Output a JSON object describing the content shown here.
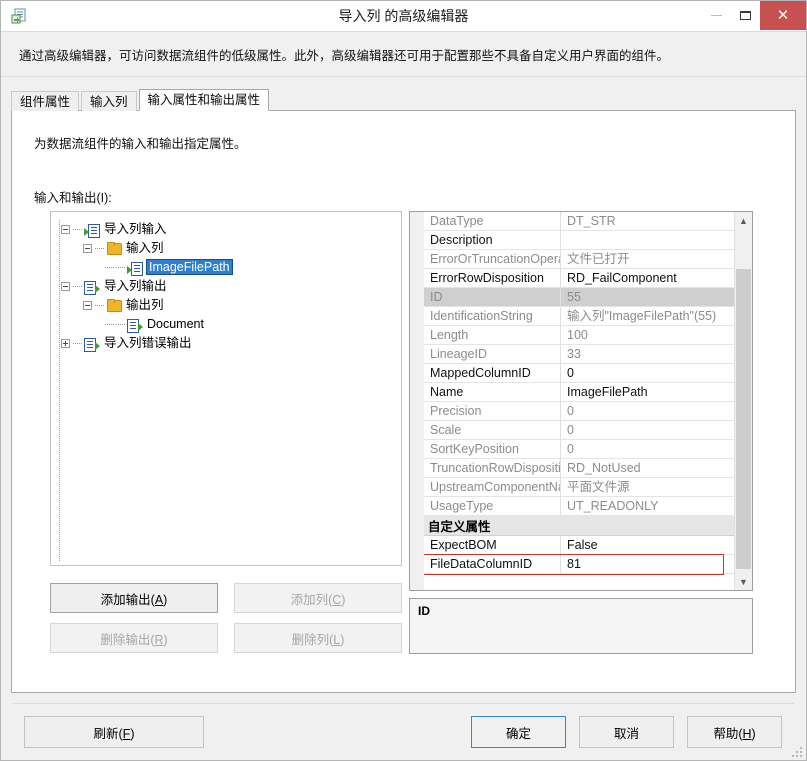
{
  "window": {
    "title": "导入列 的高级编辑器",
    "app_icon": "import-column-icon",
    "minimize_label": "最小化",
    "maximize_label": "最大化",
    "close_label": "关闭"
  },
  "description_strip": {
    "text": "通过高级编辑器，可访问数据流组件的低级属性。此外，高级编辑器还可用于配置那些不具备自定义用户界面的组件。"
  },
  "tabs": [
    {
      "label": "组件属性",
      "active": false
    },
    {
      "label": "输入列",
      "active": false
    },
    {
      "label": "输入属性和输出属性",
      "active": true
    }
  ],
  "tab_body": {
    "hint": "为数据流组件的输入和输出指定属性。",
    "io_label": "输入和输出(I):"
  },
  "tree": {
    "nodes": [
      {
        "level": 1,
        "expander": "minus",
        "icon": "input-icon",
        "label": "导入列输入",
        "selected": false
      },
      {
        "level": 2,
        "expander": "minus",
        "icon": "folder-icon",
        "label": "输入列",
        "selected": false
      },
      {
        "level": 3,
        "expander": "none",
        "icon": "input-icon",
        "label": "ImageFilePath",
        "selected": true
      },
      {
        "level": 1,
        "expander": "minus",
        "icon": "output-icon",
        "label": "导入列输出",
        "selected": false
      },
      {
        "level": 2,
        "expander": "minus",
        "icon": "folder-icon",
        "label": "输出列",
        "selected": false
      },
      {
        "level": 3,
        "expander": "none",
        "icon": "output-icon",
        "label": "Document",
        "selected": false
      },
      {
        "level": 1,
        "expander": "plus",
        "icon": "output-icon",
        "label": "导入列错误输出",
        "selected": false
      }
    ]
  },
  "tree_buttons": {
    "add_output": "添加输出(A)",
    "add_output_accel": "A",
    "add_column": "添加列(C)",
    "add_column_accel": "C",
    "remove_output": "删除输出(R)",
    "remove_output_accel": "R",
    "remove_column": "删除列(L)",
    "remove_column_accel": "L"
  },
  "property_grid": {
    "rows": [
      {
        "name": "DataType",
        "value": "DT_STR",
        "readonly": true,
        "selected": false,
        "highlight": false
      },
      {
        "name": "Description",
        "value": "",
        "readonly": false,
        "selected": false,
        "highlight": false
      },
      {
        "name": "ErrorOrTruncationOperati",
        "value": "文件已打开",
        "readonly": true,
        "selected": false,
        "highlight": false
      },
      {
        "name": "ErrorRowDisposition",
        "value": "RD_FailComponent",
        "readonly": false,
        "selected": false,
        "highlight": false
      },
      {
        "name": "ID",
        "value": "55",
        "readonly": true,
        "selected": true,
        "highlight": false
      },
      {
        "name": "IdentificationString",
        "value": "输入列\"ImageFilePath\"(55)",
        "readonly": true,
        "selected": false,
        "highlight": false
      },
      {
        "name": "Length",
        "value": "100",
        "readonly": true,
        "selected": false,
        "highlight": false
      },
      {
        "name": "LineageID",
        "value": "33",
        "readonly": true,
        "selected": false,
        "highlight": false
      },
      {
        "name": "MappedColumnID",
        "value": "0",
        "readonly": false,
        "selected": false,
        "highlight": false
      },
      {
        "name": "Name",
        "value": "ImageFilePath",
        "readonly": false,
        "selected": false,
        "highlight": false
      },
      {
        "name": "Precision",
        "value": "0",
        "readonly": true,
        "selected": false,
        "highlight": false
      },
      {
        "name": "Scale",
        "value": "0",
        "readonly": true,
        "selected": false,
        "highlight": false
      },
      {
        "name": "SortKeyPosition",
        "value": "0",
        "readonly": true,
        "selected": false,
        "highlight": false
      },
      {
        "name": "TruncationRowDisposition",
        "value": "RD_NotUsed",
        "readonly": true,
        "selected": false,
        "highlight": false
      },
      {
        "name": "UpstreamComponentNam",
        "value": "平面文件源",
        "readonly": true,
        "selected": false,
        "highlight": false
      },
      {
        "name": "UsageType",
        "value": "UT_READONLY",
        "readonly": true,
        "selected": false,
        "highlight": false
      }
    ],
    "category": {
      "label": "自定义属性",
      "expanded": true
    },
    "custom_rows": [
      {
        "name": "ExpectBOM",
        "value": "False",
        "readonly": false,
        "selected": false,
        "highlight": false
      },
      {
        "name": "FileDataColumnID",
        "value": "81",
        "readonly": false,
        "selected": false,
        "highlight": true
      }
    ],
    "highlight_color": "#c0392b",
    "scroll_up_glyph": "▲",
    "scroll_down_glyph": "▼"
  },
  "description_pane": {
    "title": "ID"
  },
  "footer": {
    "refresh": "刷新(F)",
    "refresh_accel": "F",
    "ok": "确定",
    "cancel": "取消",
    "help": "帮助(H)",
    "help_accel": "H"
  }
}
